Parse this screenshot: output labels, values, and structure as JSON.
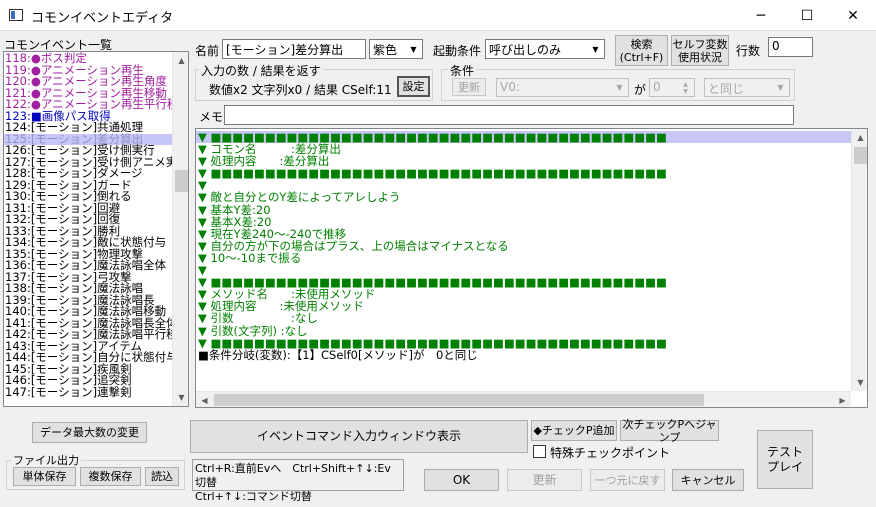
{
  "window": {
    "title": "コモンイベントエディタ",
    "minimize": "─",
    "maximize": "☐",
    "close": "✕"
  },
  "list": {
    "header": "コモンイベント一覧",
    "items": [
      {
        "text": "118:●ボス判定",
        "style": "purple"
      },
      {
        "text": "119:●アニメーション再生",
        "style": "purple"
      },
      {
        "text": "120:●アニメーション再生角度",
        "style": "purple"
      },
      {
        "text": "121:●アニメーション再生移動",
        "style": "purple"
      },
      {
        "text": "122:●アニメーション再生平行移",
        "style": "purple"
      },
      {
        "text": "123:■画像パス取得",
        "style": "blue"
      },
      {
        "text": "124:[モーション]共通処理",
        "style": ""
      },
      {
        "text": "125:[モーション]差分算出",
        "style": "sel"
      },
      {
        "text": "126:[モーション]受け側実行",
        "style": ""
      },
      {
        "text": "127:[モーション]受け側アニメ実行",
        "style": ""
      },
      {
        "text": "128:[モーション]ダメージ",
        "style": ""
      },
      {
        "text": "129:[モーション]ガード",
        "style": ""
      },
      {
        "text": "130:[モーション]倒れる",
        "style": ""
      },
      {
        "text": "131:[モーション]回避",
        "style": ""
      },
      {
        "text": "132:[モーション]回復",
        "style": ""
      },
      {
        "text": "133:[モーション]勝利",
        "style": ""
      },
      {
        "text": "134:[モーション]敵に状態付与",
        "style": ""
      },
      {
        "text": "135:[モーション]物理攻撃",
        "style": ""
      },
      {
        "text": "136:[モーション]魔法詠唱全体",
        "style": ""
      },
      {
        "text": "137:[モーション]弓攻撃",
        "style": ""
      },
      {
        "text": "138:[モーション]魔法詠唱",
        "style": ""
      },
      {
        "text": "139:[モーション]魔法詠唱長",
        "style": ""
      },
      {
        "text": "140:[モーション]魔法詠唱移動",
        "style": ""
      },
      {
        "text": "141:[モーション]魔法詠唱長全体",
        "style": ""
      },
      {
        "text": "142:[モーション]魔法詠唱平行移",
        "style": ""
      },
      {
        "text": "143:[モーション]アイテム",
        "style": ""
      },
      {
        "text": "144:[モーション]自分に状態付与",
        "style": ""
      },
      {
        "text": "145:[モーション]疾風剣",
        "style": ""
      },
      {
        "text": "146:[モーション]追突剣",
        "style": ""
      },
      {
        "text": "147:[モーション]連撃剣",
        "style": ""
      }
    ]
  },
  "header": {
    "name_label": "名前",
    "name_value": "[モーション]差分算出",
    "color_value": "紫色",
    "trigger_label": "起動条件",
    "trigger_value": "呼び出しのみ",
    "search_button": "検索\n(Ctrl+F)",
    "self_var_button": "セルフ変数\n使用状況",
    "lines_label": "行数",
    "lines_value": "0"
  },
  "io_group": {
    "title": "入力の数 / 結果を返す",
    "summary": "数値x2 文字列x0 / 結果 CSelf:11",
    "settings_button": "設定"
  },
  "condition_group": {
    "title": "条件",
    "update_button": "更新",
    "var_value": "V0:",
    "ga_label": "が",
    "num_value": "0",
    "compare_value": "と同じ"
  },
  "memo_label": "メモ",
  "editor": {
    "lines": [
      {
        "text": "▼ ■■■■■■■■■■■■■■■■■■■■■■■■■■■■■■■■■■■■■■■■■■",
        "hl": true
      },
      {
        "text": "▼ コモン名　　　:差分算出"
      },
      {
        "text": "▼ 処理内容　　:差分算出"
      },
      {
        "text": "▼ ■■■■■■■■■■■■■■■■■■■■■■■■■■■■■■■■■■■■■■■■■■"
      },
      {
        "text": "▼"
      },
      {
        "text": "▼ 敵と自分とのY差によってアレしよう"
      },
      {
        "text": "▼ 基本Y差:20"
      },
      {
        "text": "▼ 基本X差:20"
      },
      {
        "text": "▼ 現在Y差240～-240で推移"
      },
      {
        "text": "▼ 自分の方が下の場合はプラス、上の場合はマイナスとなる"
      },
      {
        "text": "▼ 10～-10まで振る"
      },
      {
        "text": "▼"
      },
      {
        "text": "▼ ■■■■■■■■■■■■■■■■■■■■■■■■■■■■■■■■■■■■■■■■■■"
      },
      {
        "text": "▼ メソッド名　　:未使用メソッド"
      },
      {
        "text": "▼ 処理内容　　:未使用メソッド"
      },
      {
        "text": "▼ 引数　　　　　:なし"
      },
      {
        "text": "▼ 引数(文字列) :なし"
      },
      {
        "text": "▼ ■■■■■■■■■■■■■■■■■■■■■■■■■■■■■■■■■■■■■■■■■■"
      },
      {
        "text": "■条件分岐(変数):【1】CSelf0[メソッド]が　0と同じ",
        "dark": true
      }
    ]
  },
  "buttons": {
    "max_data": "データ最大数の変更",
    "file_output": "ファイル出力",
    "single_save": "単体保存",
    "multi_save": "複数保存",
    "load": "読込",
    "cmd_window": "イベントコマンド入力ウィンドウ表示",
    "add_check": "◆チェックP追加",
    "next_check": "次チェックPへジャンプ",
    "special_check": "特殊チェックポイント",
    "test_play": "テスト\nプレイ",
    "ok": "OK",
    "update": "更新",
    "undo": "一つ元に戻す",
    "cancel": "キャンセル"
  },
  "hints": {
    "line1": "Ctrl+R:直前Evへ　Ctrl+Shift+↑↓:Ev切替",
    "line2": "Ctrl+↑↓:コマンド切替"
  }
}
